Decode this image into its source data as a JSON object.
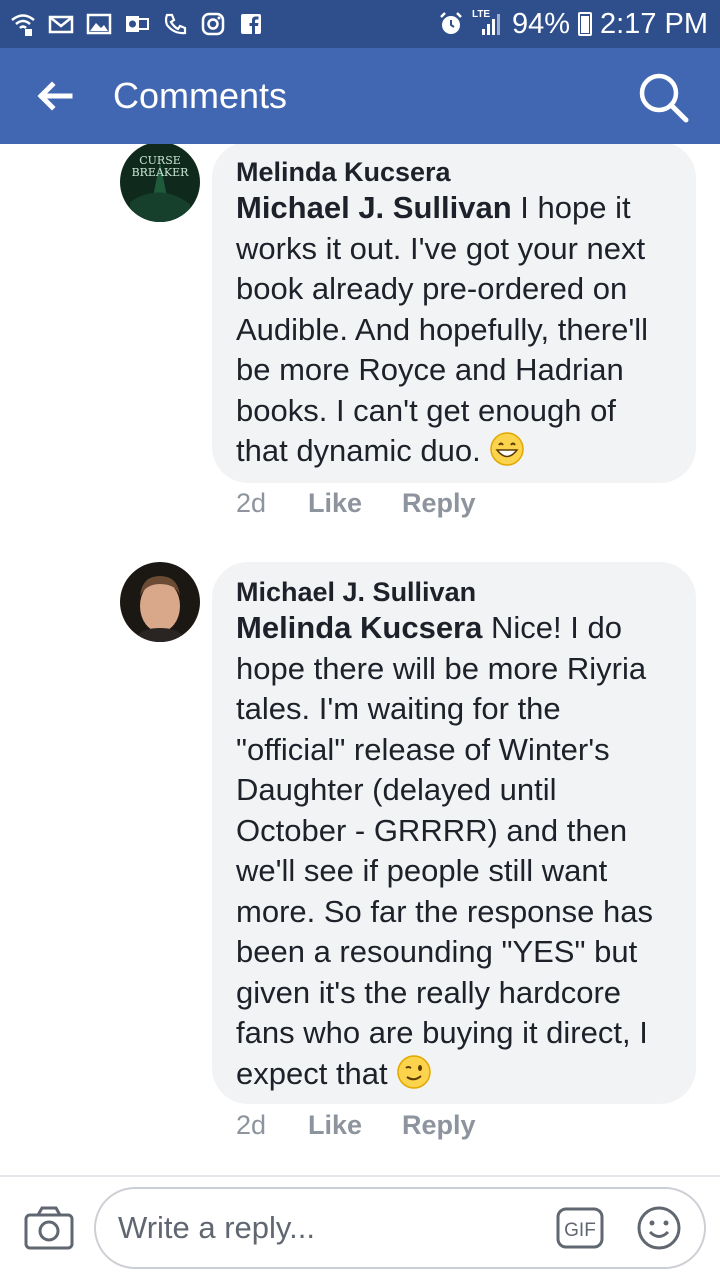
{
  "status_bar": {
    "battery": "94%",
    "time": "2:17 PM",
    "network": "LTE",
    "icons": [
      "wifi-icon",
      "mail-icon",
      "image-icon",
      "outlook-icon",
      "phone-icon",
      "instagram-icon",
      "facebook-icon",
      "alarm-icon",
      "signal-icon",
      "battery-icon"
    ]
  },
  "app_bar": {
    "title": "Comments",
    "back_icon": "arrow-left-icon",
    "search_icon": "search-icon"
  },
  "comments": [
    {
      "author": "Melinda Kucsera",
      "mention": "Michael J. Sullivan",
      "text": " I hope it works it out. I've got your next book already pre-ordered on Audible. And hopefully, there'll be more Royce and Hadrian books. I can't get enough of that dynamic duo. ",
      "emoji": "grinning-face-icon",
      "time": "2d",
      "like_label": "Like",
      "reply_label": "Reply",
      "avatar_text": [
        "CURSE",
        "BREAKER"
      ]
    },
    {
      "author": "Michael J. Sullivan",
      "mention": "Melinda Kucsera",
      "text": " Nice! I do hope there will be more Riyria tales. I'm waiting for the \"official\" release of Winter's Daughter (delayed until October - GRRRR) and then we'll see if people still want more. So far the response has been a resounding \"YES\" but given it's the really hardcore fans who are buying it direct, I expect that ",
      "emoji": "winking-face-icon",
      "time": "2d",
      "like_label": "Like",
      "reply_label": "Reply"
    }
  ],
  "composer": {
    "placeholder": "Write a reply...",
    "gif_label": "GIF",
    "camera_icon": "camera-icon",
    "emoji_icon": "smiley-icon"
  },
  "colors": {
    "status_bar": "#2f4f8c",
    "app_bar": "#4267b2",
    "bubble": "#f2f3f5",
    "meta_text": "#8d949e",
    "text": "#1d2129"
  }
}
